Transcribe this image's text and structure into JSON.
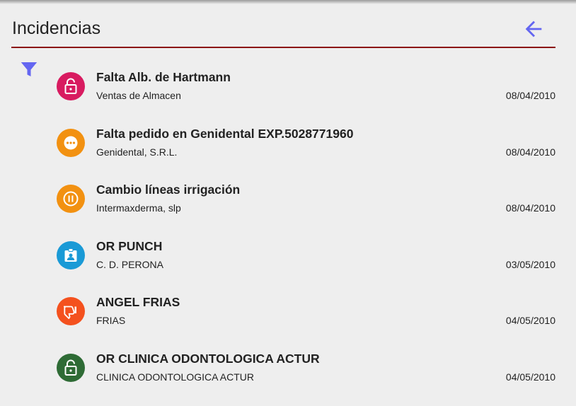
{
  "header": {
    "title": "Incidencias",
    "back_icon": "arrow-left-icon",
    "filter_icon": "filter-icon"
  },
  "colors": {
    "accent": "#6466f1",
    "header_rule": "#8b0e0e"
  },
  "incidents": [
    {
      "title": "Falta Alb. de Hartmann",
      "subtitle": "Ventas de Almacen",
      "date": "08/04/2010",
      "icon": "lock-open-icon",
      "color": "#d81b60"
    },
    {
      "title": "Falta pedido en Genidental EXP.5028771960",
      "subtitle": "Genidental, S.R.L.",
      "date": "08/04/2010",
      "icon": "more-horizontal-icon",
      "color": "#f29111"
    },
    {
      "title": "Cambio líneas irrigación",
      "subtitle": "Intermaxderma, slp",
      "date": "08/04/2010",
      "icon": "pause-circle-icon",
      "color": "#f29111"
    },
    {
      "title": "OR PUNCH",
      "subtitle": "C. D. PERONA",
      "date": "03/05/2010",
      "icon": "badge-icon",
      "color": "#1a9ad6"
    },
    {
      "title": "ANGEL FRIAS",
      "subtitle": "FRIAS",
      "date": "04/05/2010",
      "icon": "thumb-down-icon",
      "color": "#f4511e"
    },
    {
      "title": "OR CLINICA ODONTOLOGICA ACTUR",
      "subtitle": "CLINICA ODONTOLOGICA ACTUR",
      "date": "04/05/2010",
      "icon": "lock-open-icon",
      "color": "#2e6b35"
    }
  ]
}
